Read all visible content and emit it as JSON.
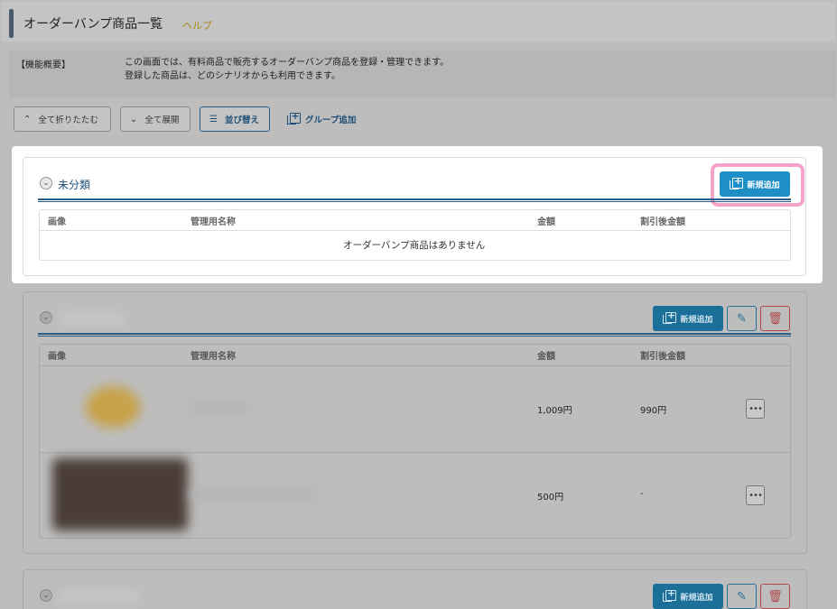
{
  "header": {
    "title": "オーダーバンプ商品一覧",
    "help_link": "ヘルプ"
  },
  "description": {
    "label": "【機能概要】",
    "line1": "この画面では、有料商品で販売するオーダーバンプ商品を登録・管理できます。",
    "line2": "登録した商品は、どのシナリオからも利用できます。"
  },
  "toolbar": {
    "collapse_all": "全て折りたたむ",
    "expand_all": "全て展開",
    "sort": "並び替え",
    "add_group": "グループ追加"
  },
  "columns": {
    "image": "画像",
    "admin_name": "管理用名称",
    "price": "金額",
    "discount_price": "割引後金額"
  },
  "groups": [
    {
      "name": "未分類",
      "add_label": "新規追加",
      "empty_message": "オーダーバンプ商品はありません"
    },
    {
      "add_label": "新規追加",
      "rows": [
        {
          "price": "1,009円",
          "discount_price": "990円"
        },
        {
          "price": "500円",
          "discount_price": "-"
        }
      ]
    },
    {
      "add_label": "新規追加"
    }
  ],
  "colors": {
    "accent": "#1e8fc6",
    "highlight": "#f7a3c9",
    "navy": "#2a5e8a",
    "help": "#a88a1c"
  }
}
